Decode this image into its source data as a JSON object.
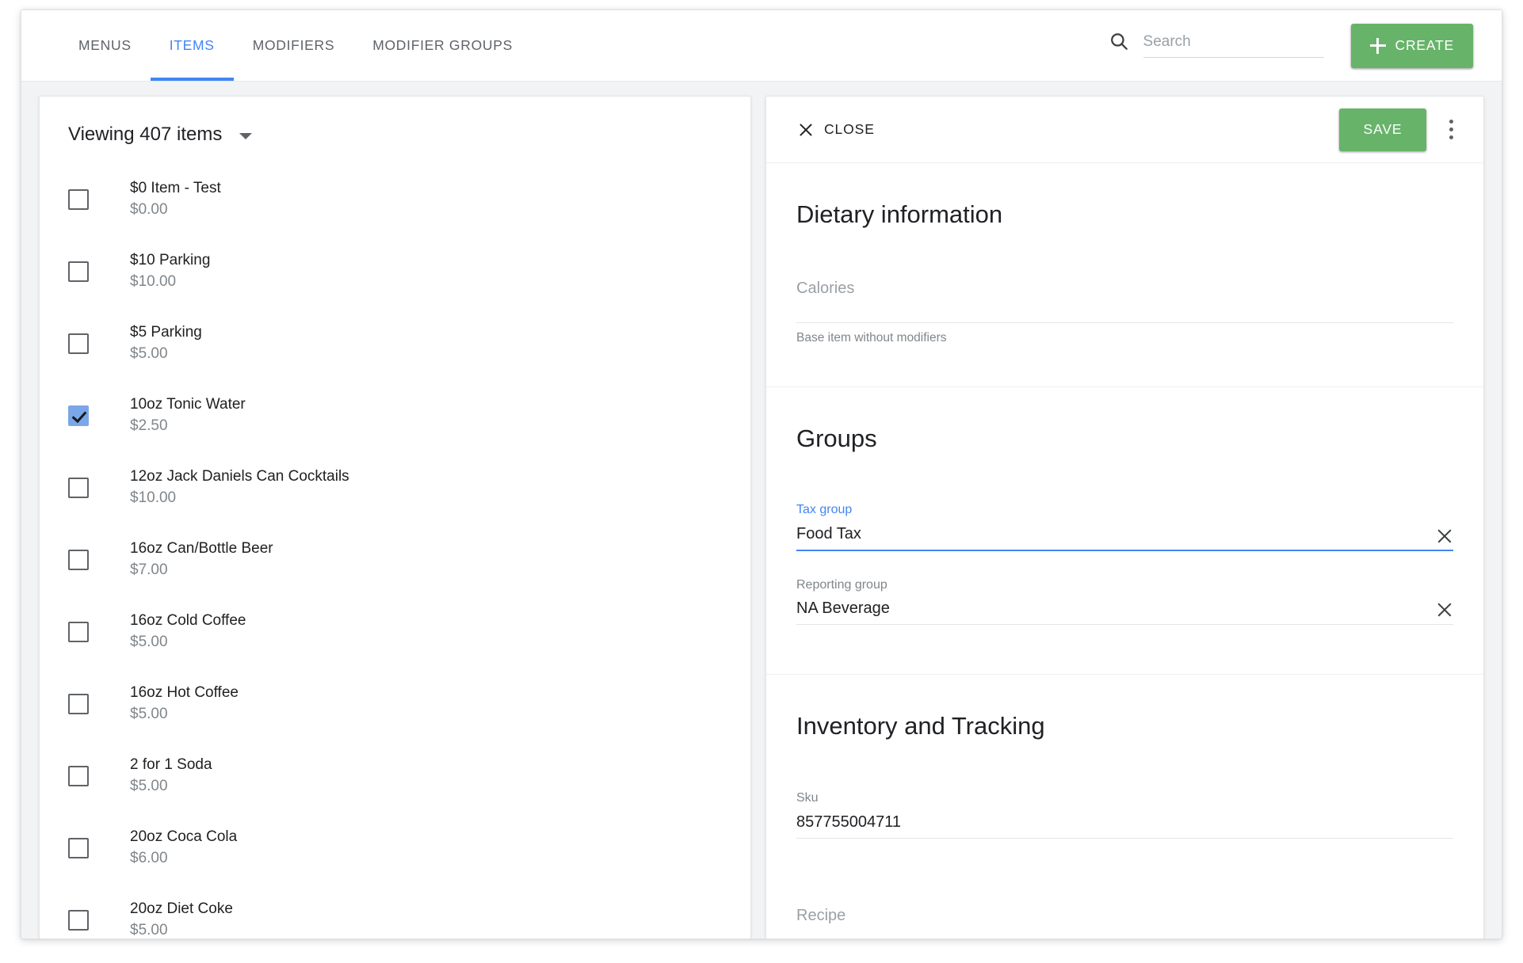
{
  "topbar": {
    "tabs": [
      {
        "label": "MENUS",
        "active": false
      },
      {
        "label": "ITEMS",
        "active": true
      },
      {
        "label": "MODIFIERS",
        "active": false
      },
      {
        "label": "MODIFIER GROUPS",
        "active": false
      }
    ],
    "search": {
      "value": "",
      "placeholder": "Search"
    },
    "create_label": "CREATE"
  },
  "left_panel": {
    "viewing_label": "Viewing 407 items",
    "items": [
      {
        "name": "$0 Item - Test",
        "price": "$0.00",
        "checked": false
      },
      {
        "name": "$10 Parking",
        "price": "$10.00",
        "checked": false
      },
      {
        "name": "$5 Parking",
        "price": "$5.00",
        "checked": false
      },
      {
        "name": "10oz Tonic Water",
        "price": "$2.50",
        "checked": true
      },
      {
        "name": "12oz Jack Daniels Can Cocktails",
        "price": "$10.00",
        "checked": false
      },
      {
        "name": "16oz Can/Bottle Beer",
        "price": "$7.00",
        "checked": false
      },
      {
        "name": "16oz Cold Coffee",
        "price": "$5.00",
        "checked": false
      },
      {
        "name": "16oz Hot Coffee",
        "price": "$5.00",
        "checked": false
      },
      {
        "name": "2 for 1 Soda",
        "price": "$5.00",
        "checked": false
      },
      {
        "name": "20oz Coca Cola",
        "price": "$6.00",
        "checked": false
      },
      {
        "name": "20oz Diet Coke",
        "price": "$5.00",
        "checked": false
      }
    ]
  },
  "detail": {
    "close_label": "CLOSE",
    "save_label": "SAVE",
    "dietary": {
      "title": "Dietary information",
      "calories": {
        "label": "Calories",
        "value": "",
        "hint": "Base item without modifiers"
      }
    },
    "groups": {
      "help_glyph": "?",
      "title": "Groups",
      "tax_group": {
        "label": "Tax group",
        "value": "Food Tax"
      },
      "reporting_group": {
        "label": "Reporting group",
        "value": "NA Beverage"
      }
    },
    "inventory": {
      "title": "Inventory and Tracking",
      "sku": {
        "label": "Sku",
        "value": "857755004711"
      },
      "recipe": {
        "label": "Recipe",
        "value": ""
      }
    }
  },
  "colors": {
    "accent_blue": "#4285f4",
    "accent_green": "#67b36a",
    "checkbox_blue": "#7ba7e8"
  }
}
